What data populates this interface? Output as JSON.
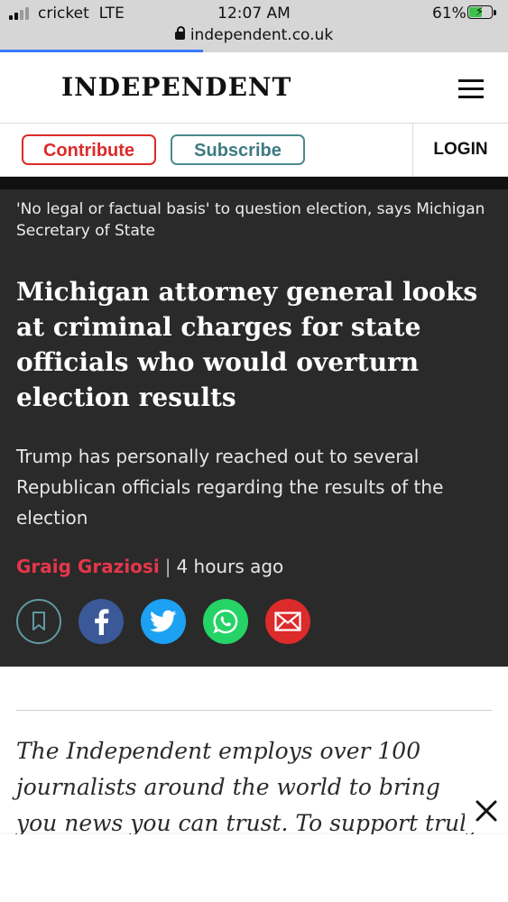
{
  "status_bar": {
    "carrier": "cricket",
    "network": "LTE",
    "time": "12:07 AM",
    "battery_percent": "61%",
    "battery_level": 0.61,
    "url": "independent.co.uk",
    "page_load_progress": 0.4
  },
  "header": {
    "logo": "INDEPENDENT",
    "menu_icon": "hamburger-menu-icon"
  },
  "actions": {
    "contribute_label": "Contribute",
    "subscribe_label": "Subscribe",
    "login_label": "LOGIN"
  },
  "article": {
    "related_link": "'No legal or factual basis' to question election, says Michigan Secretary of State",
    "headline": "Michigan attorney general looks at criminal charges for state officials who would overturn election results",
    "standfirst": "Trump has personally reached out to several Republican officials regarding the results of the election",
    "author": "Graig Graziosi",
    "separator": "|",
    "published": "4 hours ago",
    "share_icons": [
      "bookmark-icon",
      "facebook-icon",
      "twitter-icon",
      "whatsapp-icon",
      "email-icon"
    ]
  },
  "promo": {
    "text": "The Independent employs over 100 journalists around the world to bring you news you can trust. To support truly"
  },
  "colors": {
    "contribute": "#dd2a2a",
    "subscribe": "#4b8a8e",
    "author": "#e5364a",
    "dark_bg": "#2a2a2a"
  }
}
